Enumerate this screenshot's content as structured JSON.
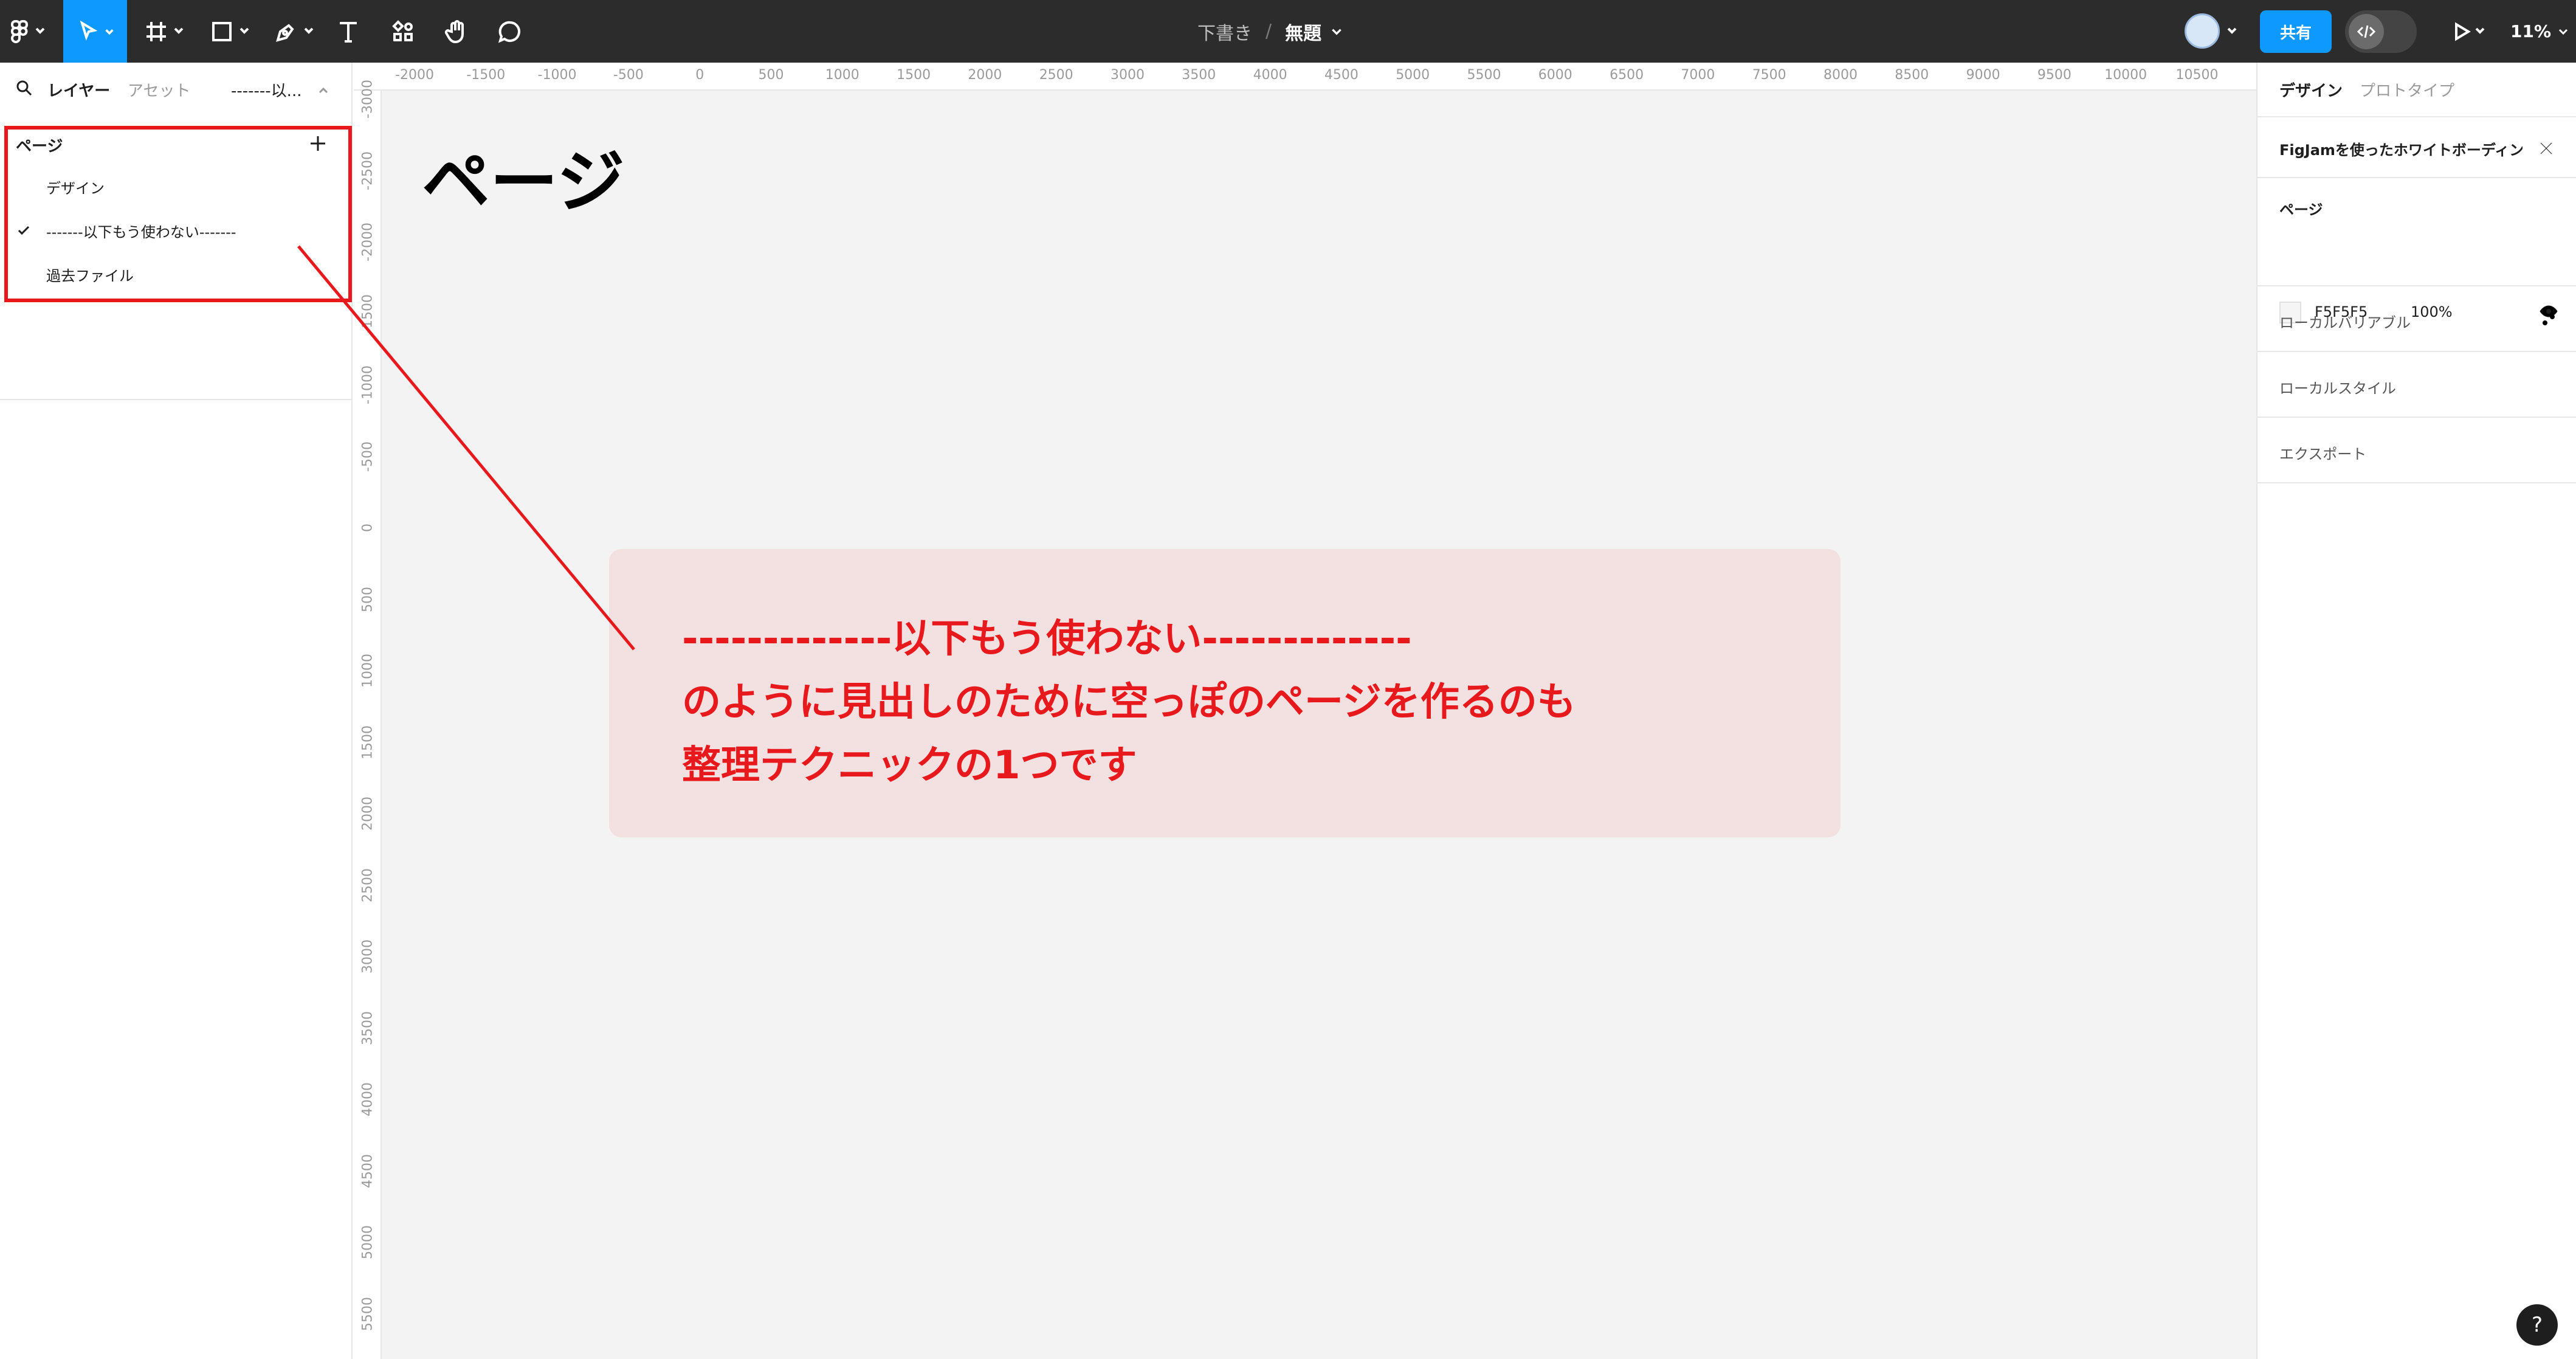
{
  "toolbar": {
    "tools": [
      "main-menu",
      "move",
      "frame",
      "shape",
      "pen",
      "text",
      "resources",
      "hand",
      "comment"
    ],
    "doc": {
      "folder": "下書き",
      "separator": "/",
      "name": "無題"
    },
    "share_label": "共有",
    "zoom": "11%"
  },
  "left_panel": {
    "tabs": {
      "layers": "レイヤー",
      "assets": "アセット",
      "current_page": "-------以..."
    },
    "pages_header": "ページ",
    "pages": [
      {
        "label": "デザイン",
        "selected": false
      },
      {
        "label": "-------以下もう使わない-------",
        "selected": true
      },
      {
        "label": "過去ファイル",
        "selected": false
      }
    ]
  },
  "canvas": {
    "ruler_x": [
      "-2000",
      "-1500",
      "-1000",
      "-500",
      "0",
      "500",
      "1000",
      "1500",
      "2000",
      "2500",
      "3000",
      "3500",
      "4000",
      "4500",
      "5000",
      "5500",
      "6000",
      "6500",
      "7000",
      "7500",
      "8000",
      "8500",
      "9000",
      "9500",
      "10000",
      "10500"
    ],
    "ruler_y": [
      "-3000",
      "-2500",
      "-2000",
      "-1500",
      "-1000",
      "-500",
      "0",
      "500",
      "1000",
      "1500",
      "2000",
      "2500",
      "3000",
      "3500",
      "4000",
      "4500",
      "5000",
      "5500"
    ],
    "page_heading": "ページ",
    "callout_lines": [
      "-------------以下もう使わない-------------",
      "のように見出しのために空っぽのページを作るのも",
      "整理テクニックの1つです"
    ],
    "background": "#f4f3f3"
  },
  "right_panel": {
    "tabs": {
      "design": "デザイン",
      "prototype": "プロトタイプ"
    },
    "banner": "FigJamを使ったホワイトボーディング",
    "page_section": {
      "title": "ページ",
      "color_hex": "F5F5F5",
      "opacity": "100%"
    },
    "local_variables": "ローカルバリアブル",
    "local_styles": "ローカルスタイル",
    "export": "エクスポート"
  },
  "help_label": "?",
  "colors": {
    "accent": "#0d99ff",
    "annotation_red": "#e8191c",
    "callout_bg": "#f3e1e1",
    "toolbar_bg": "#2c2c2c"
  }
}
